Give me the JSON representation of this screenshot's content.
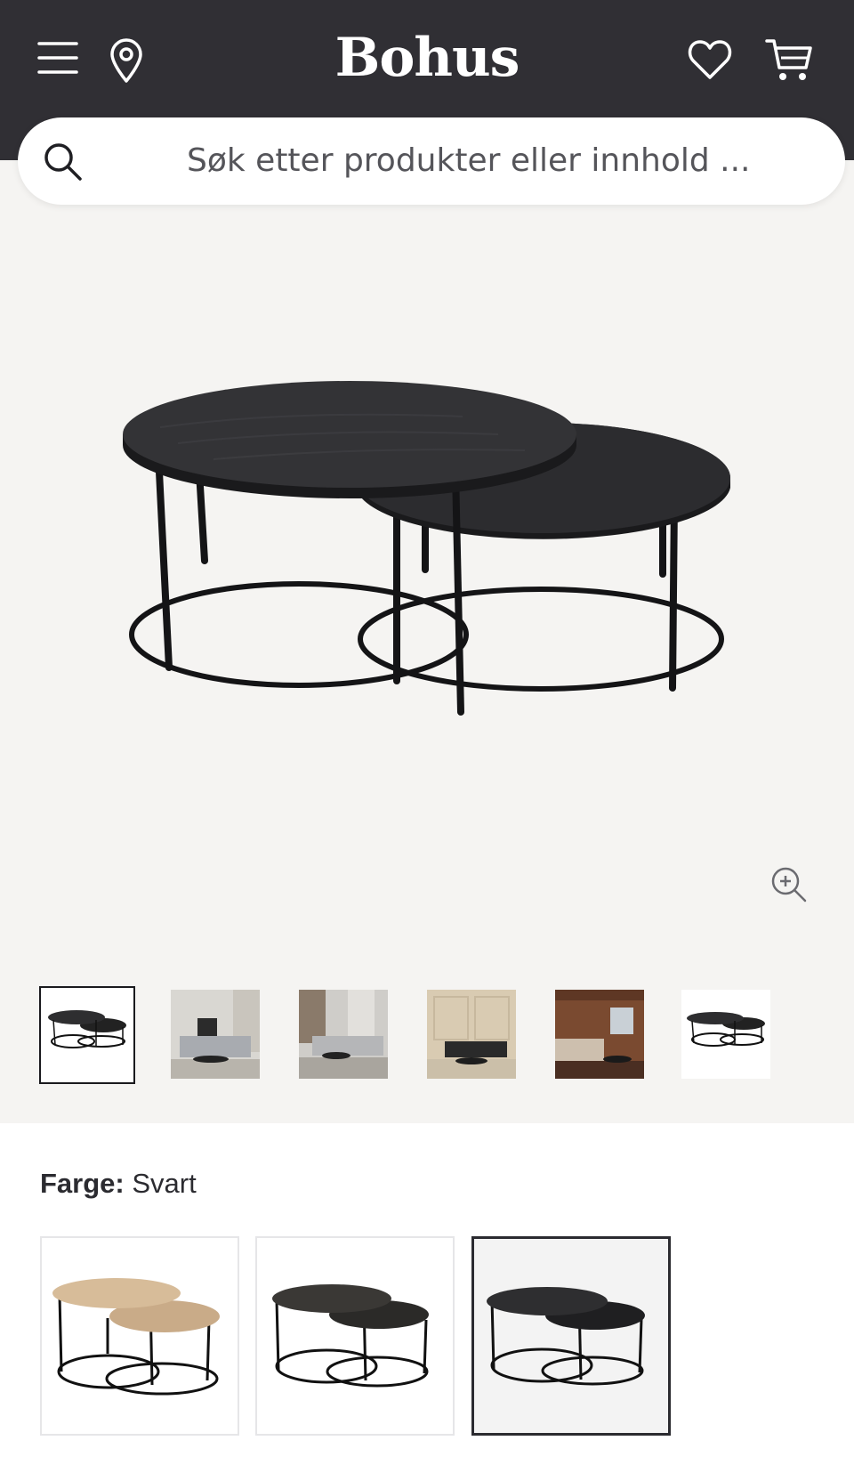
{
  "header": {
    "logo": "Bohus",
    "menu_icon": "hamburger-menu-icon",
    "location_icon": "map-pin-icon",
    "wishlist_icon": "heart-icon",
    "cart_icon": "shopping-cart-icon"
  },
  "search": {
    "placeholder": "Søk etter produkter eller innhold ..."
  },
  "gallery": {
    "zoom_icon": "zoom-in-icon",
    "thumbnails": [
      {
        "name": "thumb-product"
      },
      {
        "name": "thumb-livingroom-grey"
      },
      {
        "name": "thumb-livingroom-window"
      },
      {
        "name": "thumb-livingroom-beige"
      },
      {
        "name": "thumb-cabin-interior"
      },
      {
        "name": "thumb-product-white"
      }
    ]
  },
  "variant": {
    "label": "Farge:",
    "value": "Svart",
    "swatches": [
      {
        "name": "Natur"
      },
      {
        "name": "Mørk brun"
      },
      {
        "name": "Svart"
      }
    ]
  },
  "colors": {
    "header_bg": "#302f34",
    "page_bg": "#f5f4f2",
    "text": "#2b2b30"
  }
}
